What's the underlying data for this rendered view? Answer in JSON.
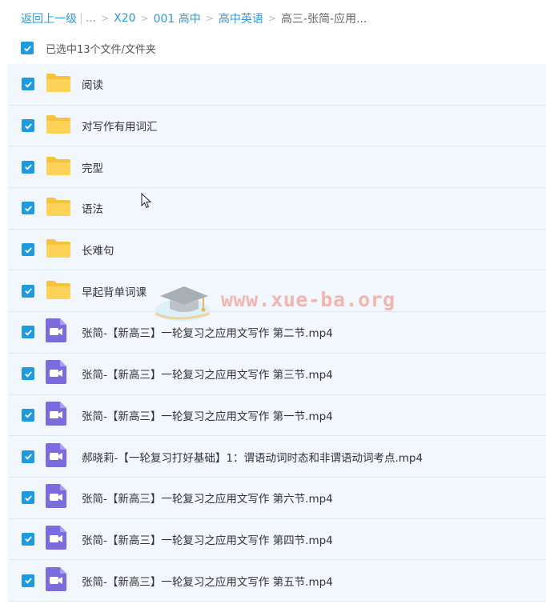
{
  "breadcrumb": {
    "back_label": "返回上一级",
    "ellipsis": "...",
    "items": [
      "X20",
      "001 高中",
      "高中英语"
    ],
    "current": "高三-张简-应用..."
  },
  "selection": {
    "label": "已选中13个文件/文件夹"
  },
  "files": [
    {
      "name": "阅读",
      "type": "folder"
    },
    {
      "name": "对写作有用词汇",
      "type": "folder"
    },
    {
      "name": "完型",
      "type": "folder"
    },
    {
      "name": "语法",
      "type": "folder"
    },
    {
      "name": "长难句",
      "type": "folder"
    },
    {
      "name": "早起背单词课",
      "type": "folder"
    },
    {
      "name": "张简-【新高三】一轮复习之应用文写作 第二节.mp4",
      "type": "video"
    },
    {
      "name": "张简-【新高三】一轮复习之应用文写作 第三节.mp4",
      "type": "video"
    },
    {
      "name": "张简-【新高三】一轮复习之应用文写作 第一节.mp4",
      "type": "video"
    },
    {
      "name": "郝晓莉-【一轮复习打好基础】1：谓语动词时态和非谓语动词考点.mp4",
      "type": "video"
    },
    {
      "name": "张简-【新高三】一轮复习之应用文写作 第六节.mp4",
      "type": "video"
    },
    {
      "name": "张简-【新高三】一轮复习之应用文写作 第四节.mp4",
      "type": "video"
    },
    {
      "name": "张简-【新高三】一轮复习之应用文写作 第五节.mp4",
      "type": "video"
    }
  ],
  "watermark": {
    "text": "www.xue-ba.org"
  },
  "colors": {
    "link": "#2d9bd8",
    "checkbox": "#1e9bdf",
    "row_bg": "#f1f7fc",
    "folder": "#ffcf4a",
    "video": "#7b6bde"
  }
}
